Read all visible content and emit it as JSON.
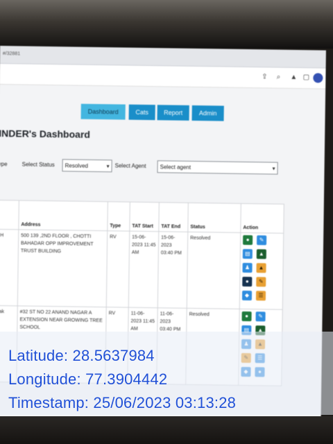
{
  "browser": {
    "address_fragment": "#/32881",
    "toolbar_icons": [
      "share-icon",
      "search-icon",
      "bell-icon",
      "window-icon",
      "profile-icon"
    ]
  },
  "nav": {
    "buttons": [
      {
        "label": "Dashboard",
        "active": true
      },
      {
        "label": "Cats",
        "active": false
      },
      {
        "label": "Report",
        "active": false
      },
      {
        "label": "Admin",
        "active": false
      }
    ]
  },
  "page": {
    "title": "INDER's Dashboard"
  },
  "filters": {
    "type_fragment": "ype",
    "status_label": "Select Status",
    "status_value": "Resolved",
    "agent_label": "Select Agent",
    "agent_value": "Select agent"
  },
  "table": {
    "headers": [
      "Address",
      "Type",
      "TAT Start",
      "TAT End",
      "Status",
      "Action"
    ],
    "rows": [
      {
        "id_fragment": "H",
        "address": "500 139 ,2ND FLOOR , CHOTTI BAHADAR OPP IMPROVEMENT TRUST BUILDING",
        "type": "RV",
        "tat_start": "15-06-2023 11:45 AM",
        "tat_end": "15-06-2023 03:40 PM",
        "status": "Resolved"
      },
      {
        "id_fragment": "ak",
        "address": "#32 ST NO 22 ANAND NAGAR A EXTENSION NEAR GROWING TREE SCHOOL",
        "type": "RV",
        "tat_start": "11-06-2023 11:45 AM",
        "tat_end": "11-06-2023 03:40 PM",
        "status": "Resolved"
      }
    ]
  },
  "gps_overlay": {
    "latitude": "Latitude: 28.5637984",
    "longitude": "Longitude: 77.3904442",
    "timestamp": "Timestamp: 25/06/2023 03:13:28"
  },
  "colors": {
    "nav_blue": "#1a8ec9",
    "nav_active": "#43b6e0",
    "overlay_text": "#1f4fd6",
    "action_green": "#1f7a3d",
    "action_blue": "#2f8ddf",
    "action_orange": "#e8a033"
  }
}
